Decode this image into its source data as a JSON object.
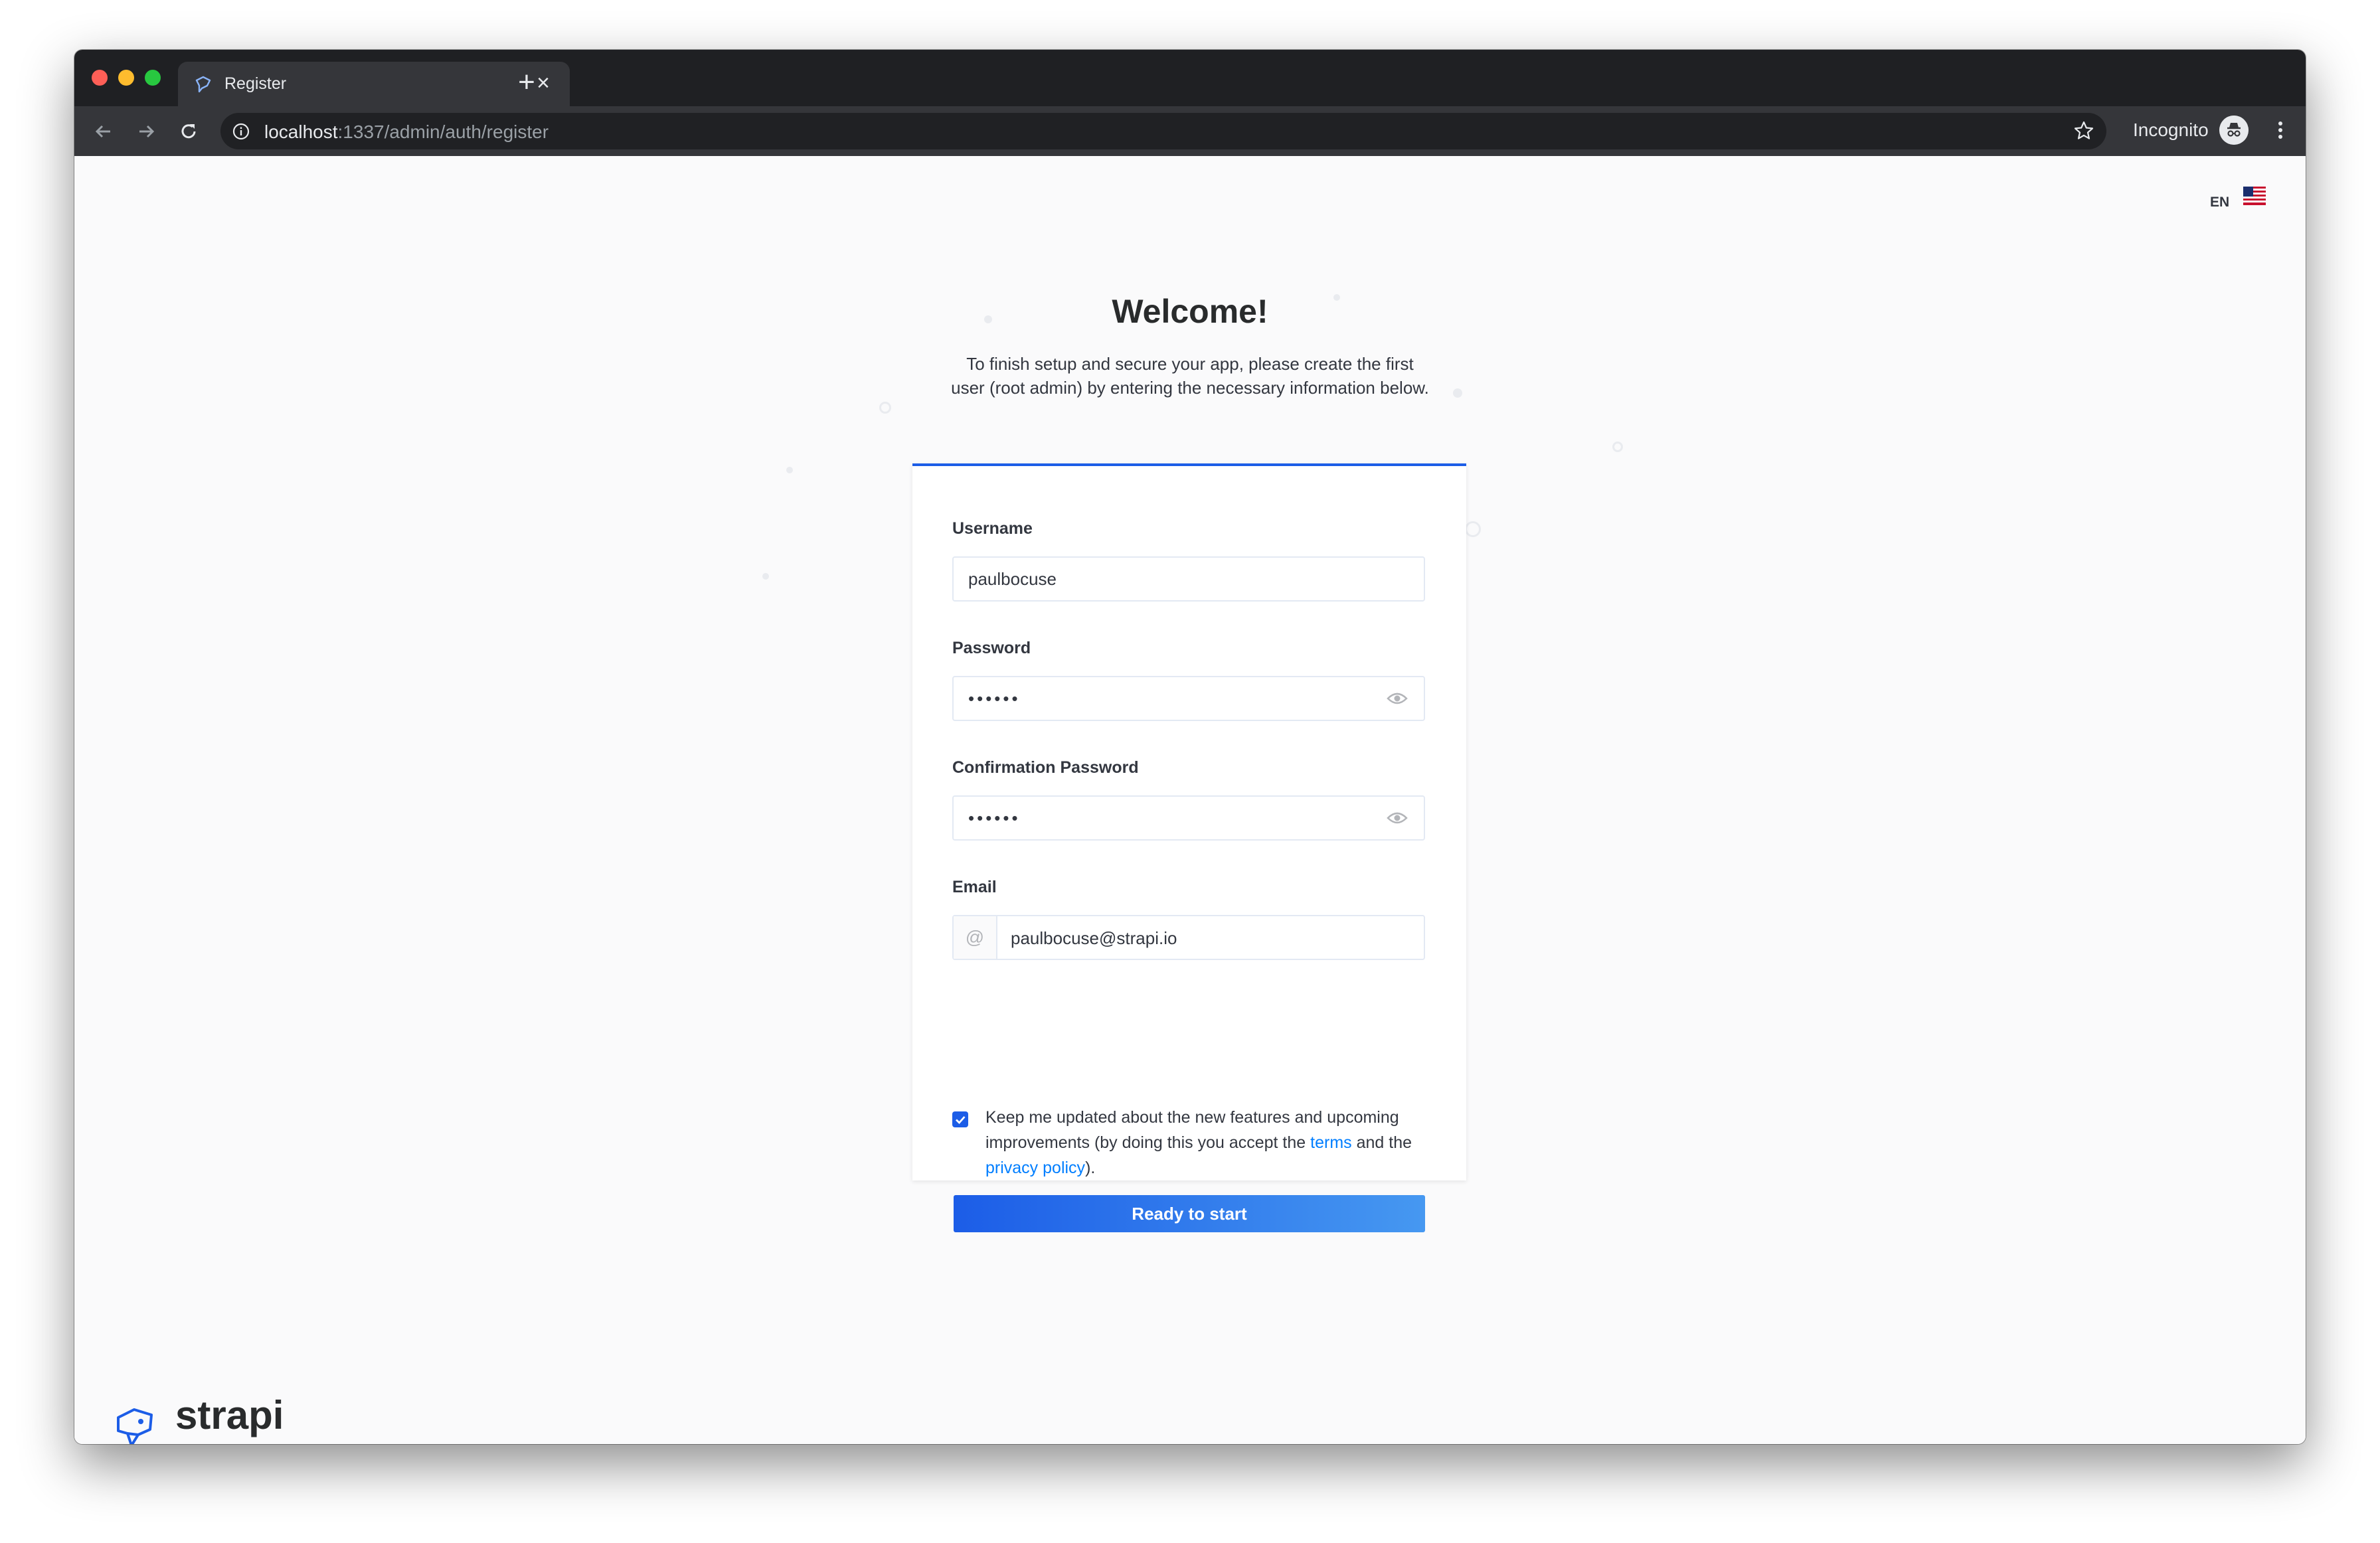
{
  "browser": {
    "tab_title": "Register",
    "tab_close_glyph": "×",
    "new_tab_glyph": "+",
    "url_host": "localhost",
    "url_path": ":1337/admin/auth/register",
    "incognito_label": "Incognito"
  },
  "page": {
    "language": "EN",
    "title": "Welcome!",
    "subtitle": "To finish setup and secure your app, please create the first user (root admin) by entering the necessary information below."
  },
  "form": {
    "username": {
      "label": "Username",
      "value": "paulbocuse"
    },
    "password": {
      "label": "Password",
      "value": "••••••"
    },
    "confirm_password": {
      "label": "Confirmation Password",
      "value": "••••••"
    },
    "email": {
      "label": "Email",
      "prefix": "@",
      "value": "paulbocuse@strapi.io"
    },
    "newsletter": {
      "checked": true,
      "text_before": "Keep me updated about the new features and upcoming improvements (by doing this you accept the ",
      "terms_link": "terms",
      "text_middle": " and the ",
      "privacy_link": "privacy policy",
      "text_after": ")."
    },
    "submit_label": "Ready to start"
  },
  "brand": {
    "name": "strapi"
  },
  "colors": {
    "accent": "#1c5de7",
    "link": "#007eff"
  },
  "icons": [
    "strapi-favicon",
    "back-arrow-icon",
    "forward-arrow-icon",
    "reload-icon",
    "info-icon",
    "star-icon",
    "incognito-icon",
    "kebab-menu-icon",
    "us-flag-icon",
    "eye-icon",
    "check-icon",
    "strapi-logo-icon"
  ]
}
